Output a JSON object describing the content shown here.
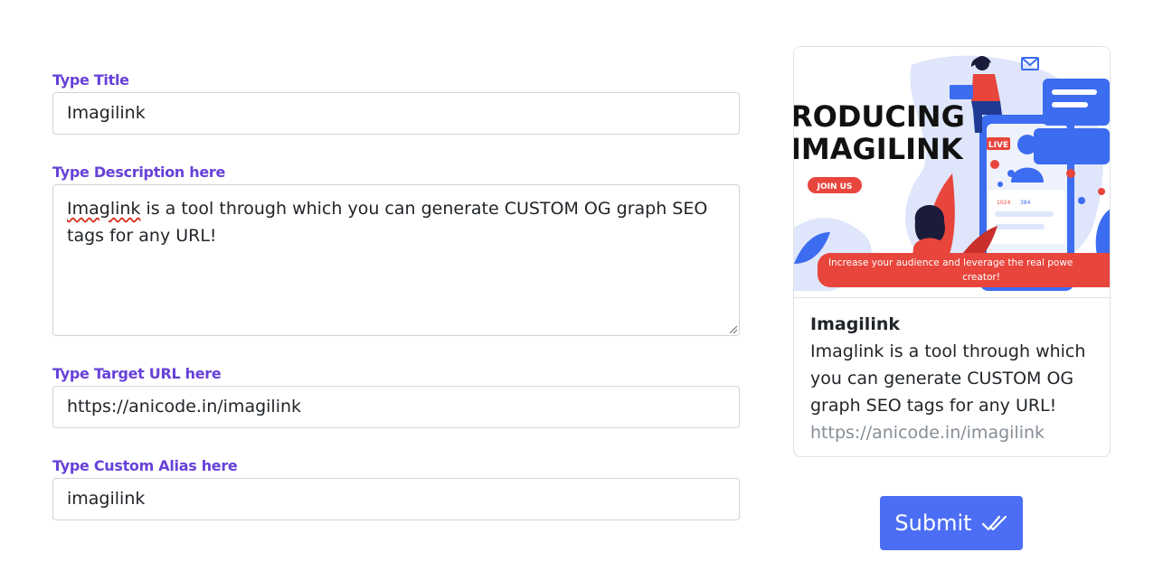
{
  "form": {
    "title_label": "Type Title",
    "title_value": "Imagilink",
    "description_label": "Type Description here",
    "description_value_misspelled": "Imaglink",
    "description_value_rest": " is a tool through which you can generate CUSTOM OG graph SEO tags for any URL!",
    "url_label": "Type Target URL here",
    "url_value": "https://anicode.in/imagilink",
    "alias_label": "Type Custom Alias here",
    "alias_value": "imagilink"
  },
  "preview": {
    "image": {
      "headline_line1": "RODUCING",
      "headline_line2": "IMAGILINK",
      "join_label": "JOIN US",
      "live_label": "LIVE",
      "banner_line1": "Increase your audience and leverage the real powe",
      "banner_line2": "creator!",
      "stat_like": "1024",
      "stat_comment": "384",
      "colors": {
        "primary_blue": "#3c6cf0",
        "accent_red": "#e8453c",
        "light_blue": "#dfe6fb"
      }
    },
    "title": "Imagilink",
    "description": "Imaglink is a tool through which you can generate CUSTOM OG graph SEO tags for any URL!",
    "url": "https://anicode.in/imagilink"
  },
  "submit": {
    "label": "Submit",
    "icon": "double-check-icon",
    "color": "#4c6ef5"
  }
}
